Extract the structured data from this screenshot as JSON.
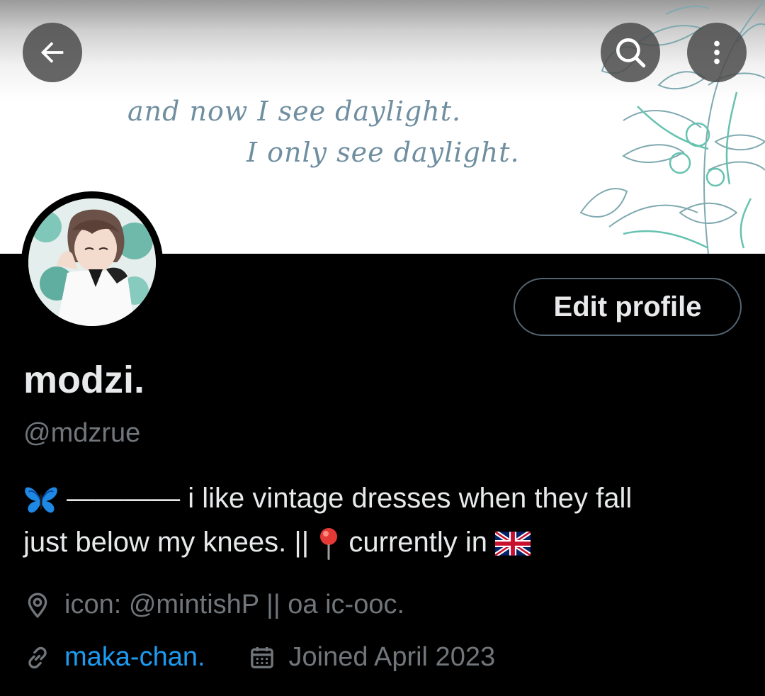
{
  "banner": {
    "quote_line1": "and now I see daylight.",
    "quote_line2": "I only see daylight."
  },
  "header": {
    "back_icon": "arrow-left-icon",
    "search_icon": "search-icon",
    "more_icon": "more-vertical-icon"
  },
  "profile": {
    "edit_label": "Edit profile",
    "display_name": "modzi.",
    "handle": "@mdzrue",
    "bio_line1_text": "———— i like vintage dresses when they fall",
    "bio_line2_text": "just below my knees. || ",
    "bio_line2_tail": "currently in ",
    "location": "icon: @mintishP || oa ic-ooc.",
    "website": "maka-chan.",
    "joined": "Joined April 2023"
  },
  "colors": {
    "background": "#000000",
    "primary_text": "#e7e9ea",
    "secondary_text": "#71767b",
    "link": "#1d9bf0",
    "border": "#536471"
  }
}
